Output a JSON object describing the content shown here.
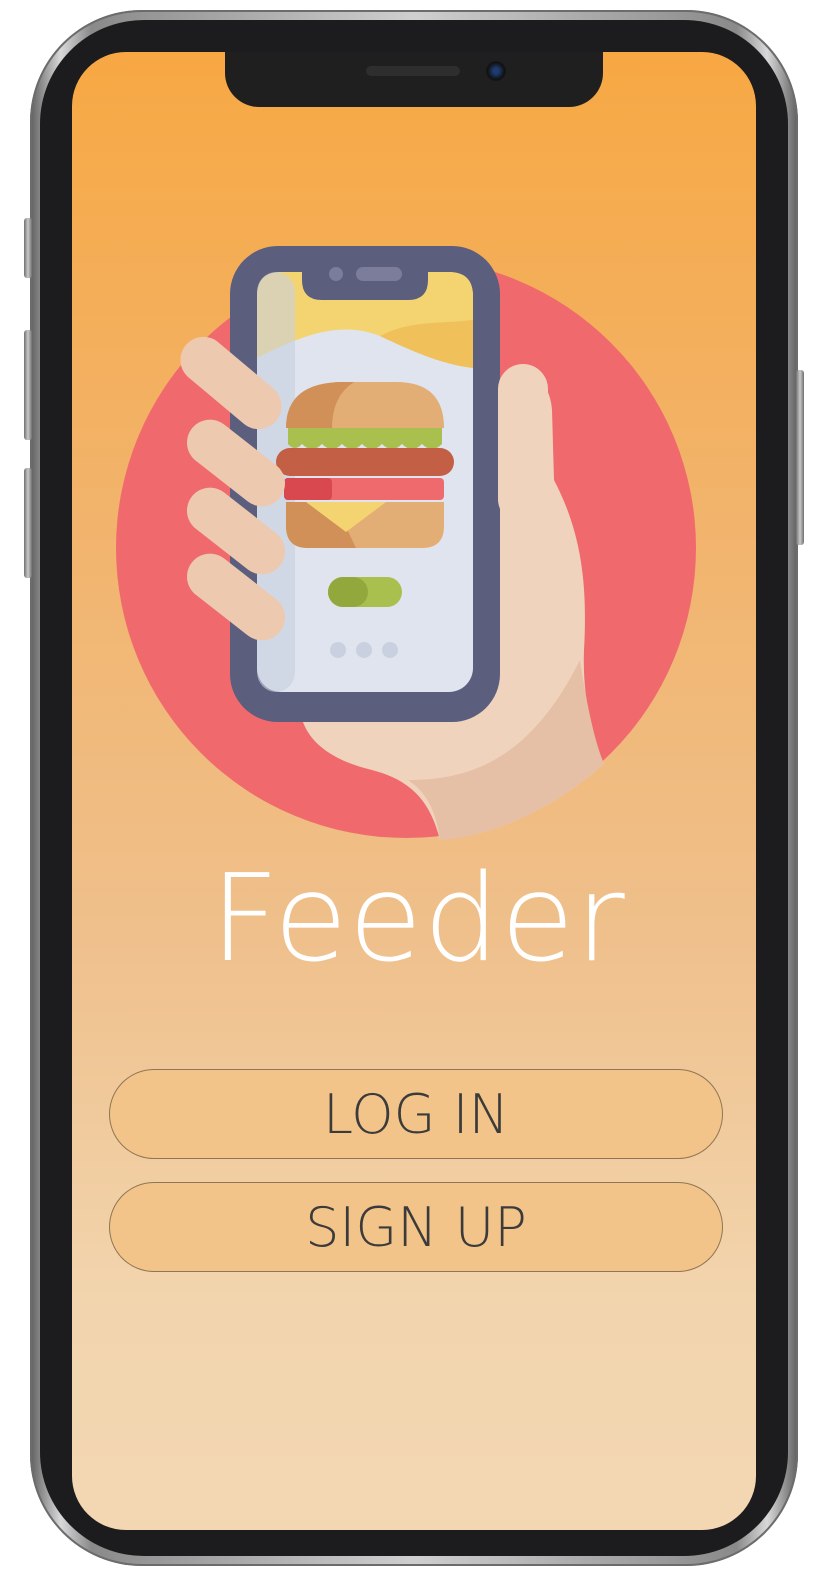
{
  "app": {
    "title": "Feeder"
  },
  "actions": {
    "login_label": "LOG IN",
    "signup_label": "SIGN UP"
  },
  "illustration": {
    "icon": "hand-holding-phone-burger-icon"
  },
  "colors": {
    "gradient_top": "#f7a843",
    "gradient_bottom": "#f3d7b3",
    "circle": "#f06a6d",
    "button_fill": "#f2c489",
    "button_text": "#3b3b3b",
    "title_text": "#ffffff"
  }
}
